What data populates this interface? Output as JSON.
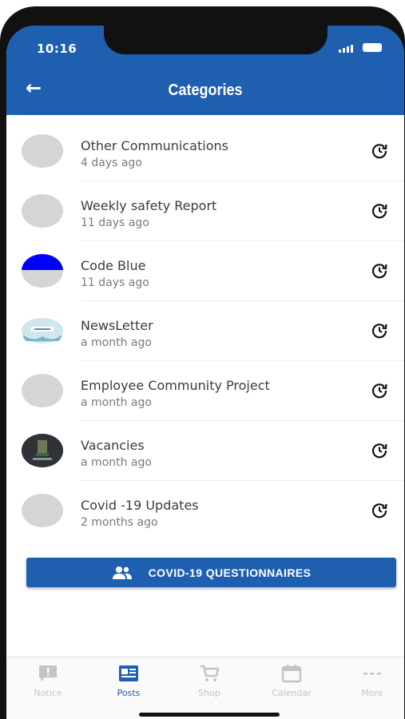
{
  "status_bar": {
    "time": "10:16"
  },
  "header": {
    "title": "Categories",
    "back_icon": "arrow-left-icon"
  },
  "categories": [
    {
      "name": "Other Communications",
      "date": "4 days ago"
    },
    {
      "name": "Weekly safety Report",
      "date": "11 days ago"
    },
    {
      "name": "Code Blue",
      "date": "11 days ago"
    },
    {
      "name": "NewsLetter",
      "date": "a month ago"
    },
    {
      "name": "Employee Community Project",
      "date": "a month ago"
    },
    {
      "name": "Vacancies",
      "date": "a month ago"
    },
    {
      "name": "Covid -19 Updates",
      "date": "2 months ago"
    }
  ],
  "questionnaire_button": {
    "label": "COVID-19 QUESTIONNAIRES",
    "icon": "people-icon"
  },
  "tabs": [
    {
      "label": "Notice",
      "icon": "notice-icon",
      "active": false
    },
    {
      "label": "Posts",
      "icon": "posts-icon",
      "active": true
    },
    {
      "label": "Shop",
      "icon": "cart-icon",
      "active": false
    },
    {
      "label": "Calendar",
      "icon": "calendar-icon",
      "active": false
    },
    {
      "label": "More",
      "icon": "more-icon",
      "active": false
    }
  ],
  "colors": {
    "brand": "#1e5fb0",
    "inactive_tab": "#c4c4c4"
  }
}
